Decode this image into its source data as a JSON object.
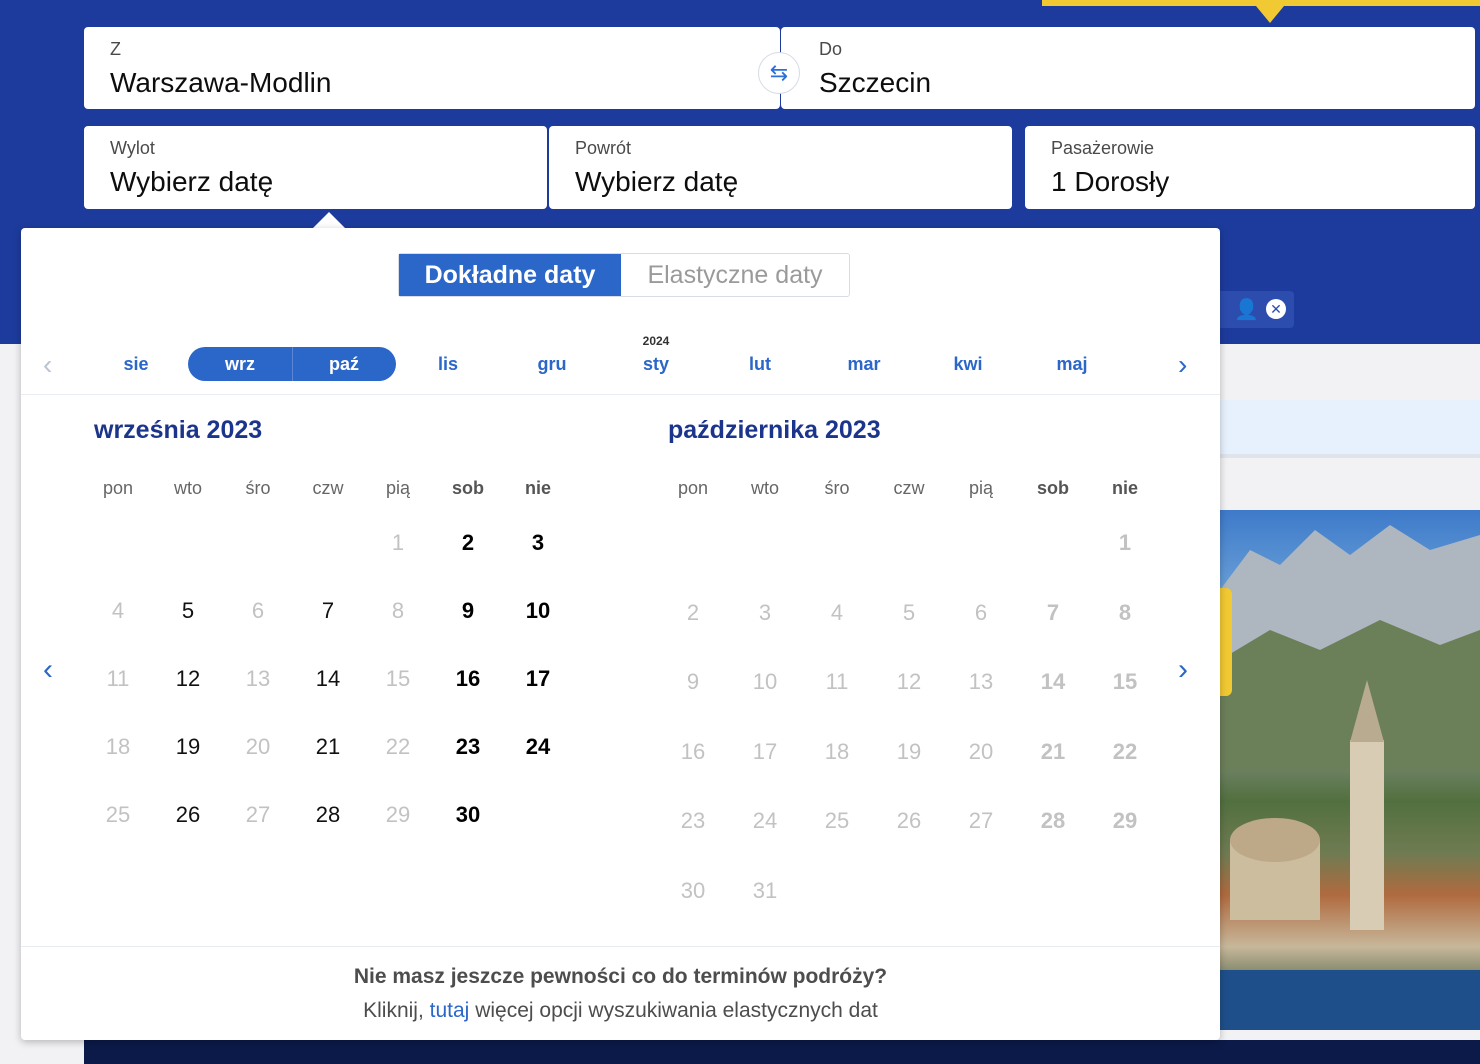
{
  "search": {
    "from": {
      "label": "Z",
      "value": "Warszawa-Modlin"
    },
    "to": {
      "label": "Do",
      "value": "Szczecin"
    },
    "depart": {
      "label": "Wylot",
      "value": "Wybierz datę"
    },
    "return": {
      "label": "Powrót",
      "value": "Wybierz datę"
    },
    "passengers": {
      "label": "Pasażerowie",
      "value": "1 Dorosły"
    }
  },
  "picker": {
    "tabs": [
      "Dokładne daty",
      "Elastyczne daty"
    ],
    "year_label": "2024",
    "months": [
      "sie",
      "wrz",
      "paź",
      "lis",
      "gru",
      "sty",
      "lut",
      "mar",
      "kwi",
      "maj"
    ],
    "selected_months": [
      "wrz",
      "paź"
    ],
    "calendars": [
      {
        "title": "września 2023",
        "weekdays": [
          "pon",
          "wto",
          "śro",
          "czw",
          "pią",
          "sob",
          "nie"
        ],
        "weeks": [
          [
            null,
            null,
            null,
            null,
            1,
            2,
            3
          ],
          [
            4,
            5,
            6,
            7,
            8,
            9,
            10
          ],
          [
            11,
            12,
            13,
            14,
            15,
            16,
            17
          ],
          [
            18,
            19,
            20,
            21,
            22,
            23,
            24
          ],
          [
            25,
            26,
            27,
            28,
            29,
            30,
            null
          ]
        ],
        "available_days": [
          2,
          3,
          5,
          7,
          9,
          10,
          12,
          14,
          16,
          17,
          19,
          21,
          23,
          24,
          26,
          28,
          30
        ]
      },
      {
        "title": "października 2023",
        "weekdays": [
          "pon",
          "wto",
          "śro",
          "czw",
          "pią",
          "sob",
          "nie"
        ],
        "weeks": [
          [
            null,
            null,
            null,
            null,
            null,
            null,
            1
          ],
          [
            2,
            3,
            4,
            5,
            6,
            7,
            8
          ],
          [
            9,
            10,
            11,
            12,
            13,
            14,
            15
          ],
          [
            16,
            17,
            18,
            19,
            20,
            21,
            22
          ],
          [
            23,
            24,
            25,
            26,
            27,
            28,
            29
          ],
          [
            30,
            31,
            null,
            null,
            null,
            null,
            null
          ]
        ],
        "available_days": []
      }
    ],
    "footer": {
      "question": "Nie masz jeszcze pewności co do terminów podróży?",
      "text_before": "Kliknij,",
      "link": "tutaj",
      "text_after": "więcej opcji wyszukiwania elastycznych dat"
    }
  },
  "colors": {
    "brand_blue": "#1d3b9c",
    "accent_blue": "#2b66c9",
    "yellow": "#f1c933",
    "heading_navy": "#1c358c"
  },
  "icons": [
    "swap-arrows-icon",
    "chevron-left-icon",
    "chevron-right-icon",
    "person-icon",
    "close-circle-icon"
  ]
}
